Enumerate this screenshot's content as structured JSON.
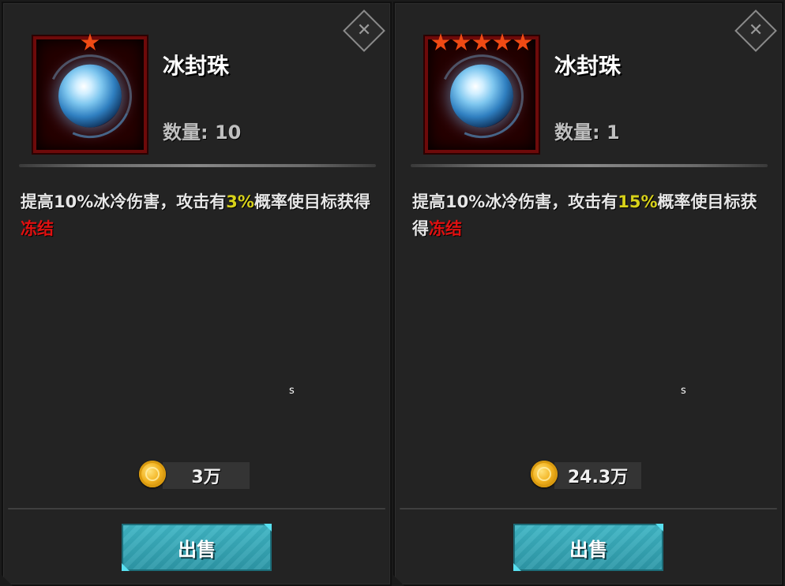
{
  "colors": {
    "highlight_percent": "#d8d21a",
    "highlight_effect": "#e01010",
    "star": "#f04a14",
    "sell_button": "#3fb5c4"
  },
  "cards": [
    {
      "name": "冰封珠",
      "stars": 1,
      "quantity": "数量: 10",
      "description": {
        "prefix": "提高10%冰冷伤害，攻击有",
        "percent": "3%",
        "middle": "概率使目标获得",
        "effect": "冻结"
      },
      "stray_char": "s",
      "price": "3万",
      "sell_label": "出售",
      "close_icon": "close-icon",
      "item_icon": "ice-orb-icon"
    },
    {
      "name": "冰封珠",
      "stars": 5,
      "quantity": "数量: 1",
      "description": {
        "prefix": "提高10%冰冷伤害，攻击有",
        "percent": "15%",
        "middle": "概率使目标获得",
        "effect": "冻结"
      },
      "stray_char": "s",
      "price": "24.3万",
      "sell_label": "出售",
      "close_icon": "close-icon",
      "item_icon": "ice-orb-icon"
    }
  ]
}
